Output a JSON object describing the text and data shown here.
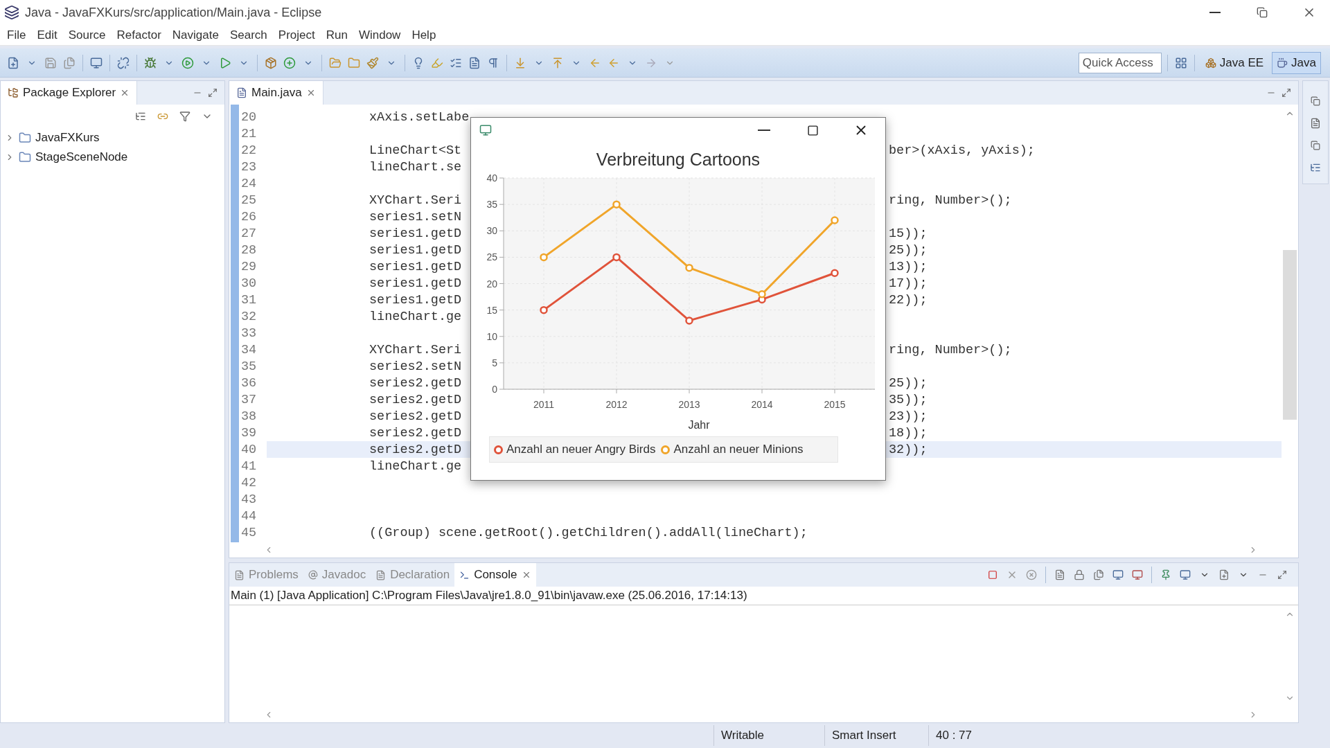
{
  "window": {
    "title": "Java - JavaFXKurs/src/application/Main.java - Eclipse"
  },
  "menu": [
    "File",
    "Edit",
    "Source",
    "Refactor",
    "Navigate",
    "Search",
    "Project",
    "Run",
    "Window",
    "Help"
  ],
  "quick_access": {
    "placeholder": "Quick Access"
  },
  "perspectives": [
    {
      "label": "Java EE",
      "selected": false
    },
    {
      "label": "Java",
      "selected": true
    }
  ],
  "package_explorer": {
    "title": "Package Explorer",
    "items": [
      {
        "label": "JavaFXKurs",
        "expanded": false
      },
      {
        "label": "StageSceneNode",
        "expanded": false
      }
    ]
  },
  "editor": {
    "tabs": [
      {
        "label": "Main.java",
        "selected": true
      }
    ],
    "lines": [
      {
        "number": "20",
        "left": "xAxis.setLabe",
        "highlighted": false
      },
      {
        "number": "21",
        "highlighted": false
      },
      {
        "number": "22",
        "left": "LineChart<St",
        "right": "ber>(xAxis, yAxis);",
        "highlighted": false
      },
      {
        "number": "23",
        "left": "lineChart.se",
        "highlighted": false
      },
      {
        "number": "24",
        "highlighted": false
      },
      {
        "number": "25",
        "left": "XYChart.Seri",
        "right": "ring, Number>();",
        "highlighted": false
      },
      {
        "number": "26",
        "left": "series1.setN",
        "highlighted": false
      },
      {
        "number": "27",
        "left": "series1.getD",
        "right": "15));",
        "highlighted": false
      },
      {
        "number": "28",
        "left": "series1.getD",
        "right": "25));",
        "highlighted": false
      },
      {
        "number": "29",
        "left": "series1.getD",
        "right": "13));",
        "highlighted": false
      },
      {
        "number": "30",
        "left": "series1.getD",
        "right": "17));",
        "highlighted": false
      },
      {
        "number": "31",
        "left": "series1.getD",
        "right": "22));",
        "highlighted": false
      },
      {
        "number": "32",
        "left": "lineChart.ge",
        "highlighted": false
      },
      {
        "number": "33",
        "highlighted": false
      },
      {
        "number": "34",
        "left": "XYChart.Seri",
        "right": "ring, Number>();",
        "highlighted": false
      },
      {
        "number": "35",
        "left": "series2.setN",
        "highlighted": false
      },
      {
        "number": "36",
        "left": "series2.getD",
        "right": "25));",
        "highlighted": false
      },
      {
        "number": "37",
        "left": "series2.getD",
        "right": "35));",
        "highlighted": false
      },
      {
        "number": "38",
        "left": "series2.getD",
        "right": "23));",
        "highlighted": false
      },
      {
        "number": "39",
        "left": "series2.getD",
        "right": "18));",
        "highlighted": false
      },
      {
        "number": "40",
        "left": "series2.getD",
        "right": "32));",
        "highlighted": true
      },
      {
        "number": "41",
        "left": "lineChart.ge",
        "highlighted": false
      },
      {
        "number": "42",
        "highlighted": false
      },
      {
        "number": "43",
        "highlighted": false
      },
      {
        "number": "44",
        "highlighted": false
      },
      {
        "number": "45",
        "left": "((Group) scene.getRoot().getChildren().addAll(lineChart);",
        "highlighted": false
      }
    ]
  },
  "chart_window": {
    "chart_data": {
      "type": "line",
      "title": "Verbreitung Cartoons",
      "xlabel": "Jahr",
      "categories": [
        "2011",
        "2012",
        "2013",
        "2014",
        "2015"
      ],
      "series": [
        {
          "name": "Anzahl an neuer Angry Birds",
          "color": "#e0533a",
          "marker": "circle",
          "values": [
            15,
            25,
            13,
            17,
            22
          ]
        },
        {
          "name": "Anzahl an neuer Minions",
          "color": "#f0a52a",
          "marker": "circle",
          "values": [
            25,
            35,
            23,
            18,
            32
          ]
        }
      ],
      "grid": true,
      "legend": true,
      "ylim": [
        0,
        40
      ],
      "yticks": [
        0,
        5,
        10,
        15,
        20,
        25,
        30,
        35,
        40
      ]
    }
  },
  "bottom_tabs": [
    {
      "label": "Problems",
      "selected": false
    },
    {
      "label": "Javadoc",
      "selected": false
    },
    {
      "label": "Declaration",
      "selected": false
    },
    {
      "label": "Console",
      "selected": true
    }
  ],
  "console": {
    "header": "Main (1) [Java Application] C:\\Program Files\\Java\\jre1.8.0_91\\bin\\javaw.exe (25.06.2016, 17:14:13)"
  },
  "status_bar": [
    "Writable",
    "Smart Insert",
    "40 : 77"
  ]
}
